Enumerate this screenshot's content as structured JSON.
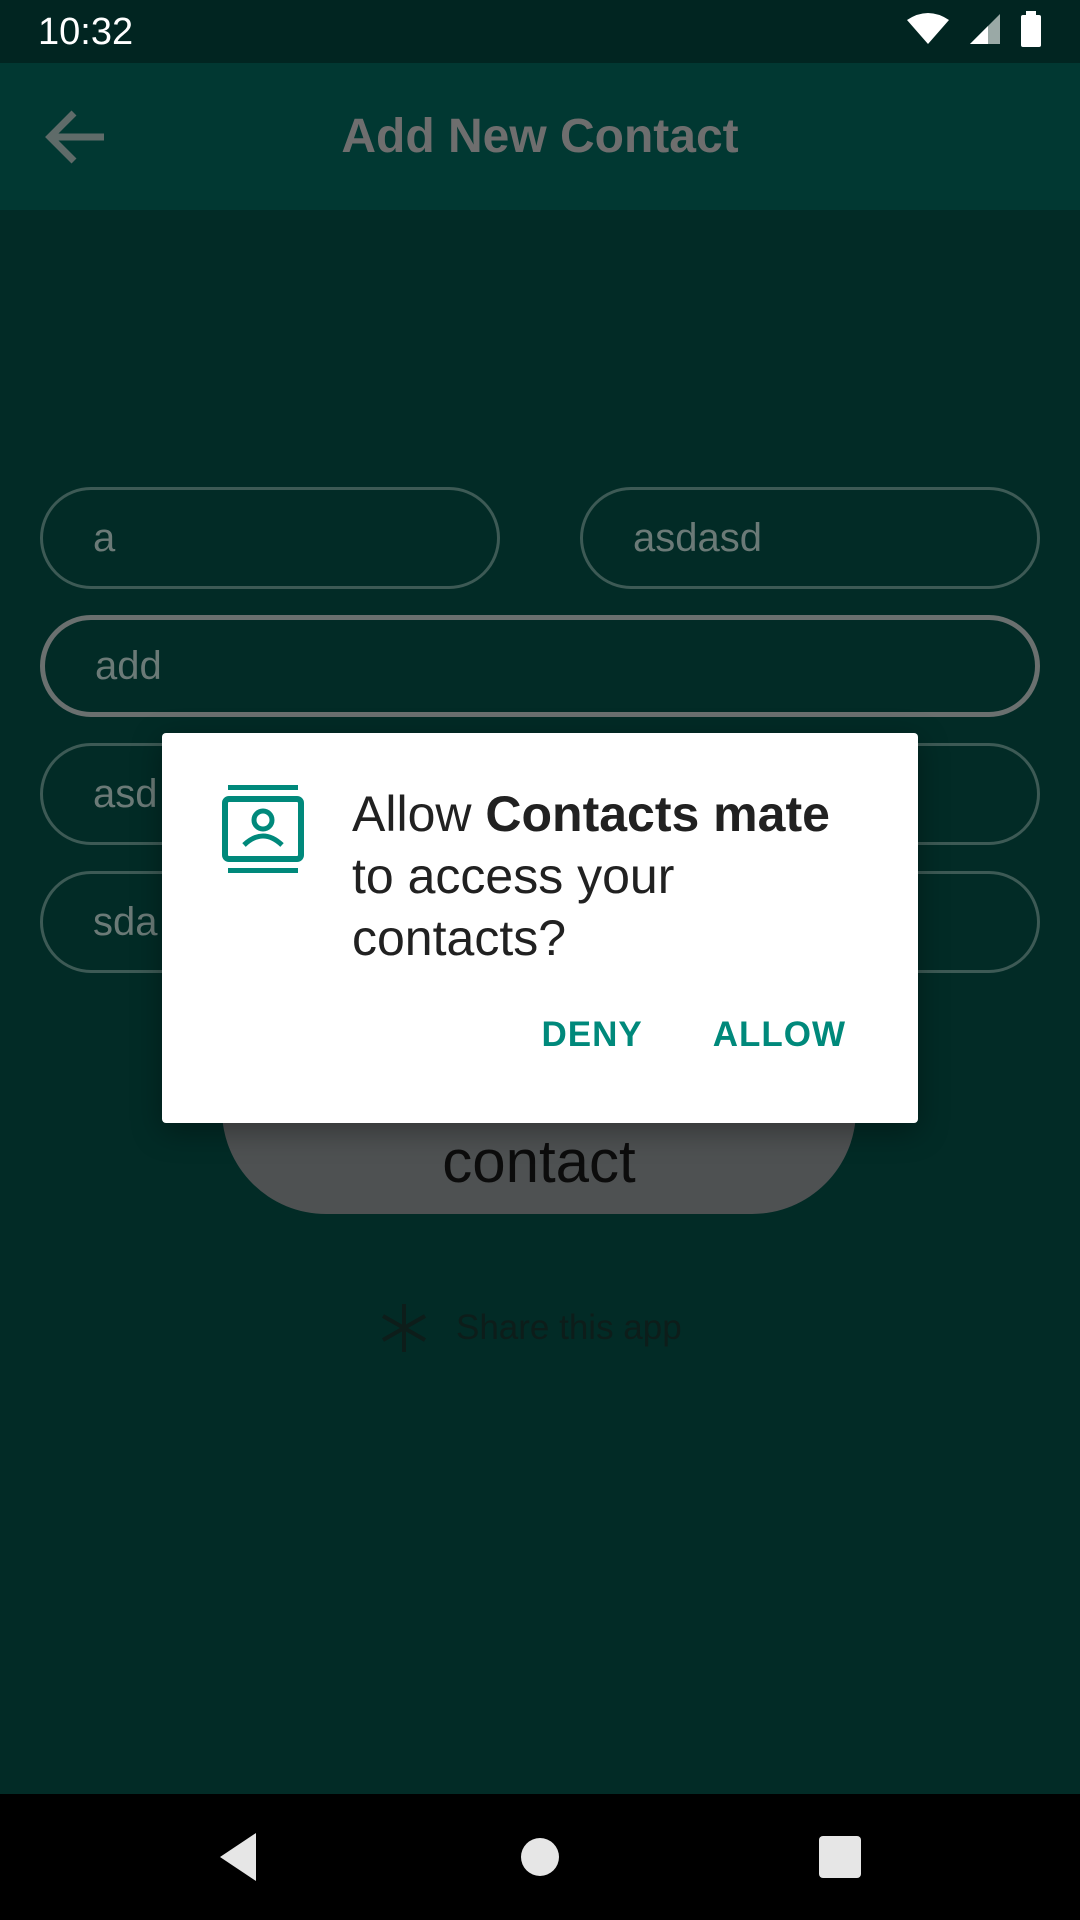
{
  "status_bar": {
    "time": "10:32",
    "icons": [
      "wifi-icon",
      "cell-signal-icon",
      "battery-icon"
    ]
  },
  "app_bar": {
    "title": "Add New Contact",
    "back_icon": "arrow-back-icon"
  },
  "form": {
    "first_name_value": "a",
    "last_name_value": "asdasd",
    "address_value": "add",
    "field4_value": "asd",
    "field5_value": "sda"
  },
  "contact_button_label": "contact",
  "share": {
    "icon": "snowflake-icon",
    "label": "Share this app"
  },
  "dialog": {
    "icon": "contacts-icon",
    "message_prefix": "Allow ",
    "app_name": "Contacts mate",
    "message_suffix": " to access your contacts?",
    "deny_label": "DENY",
    "allow_label": "ALLOW"
  },
  "nav_bar": {
    "back": "nav-back-icon",
    "home": "nav-home-icon",
    "recents": "nav-recents-icon"
  },
  "colors": {
    "accent": "#00897b",
    "app_bar": "#013832",
    "background": "#022b26"
  }
}
